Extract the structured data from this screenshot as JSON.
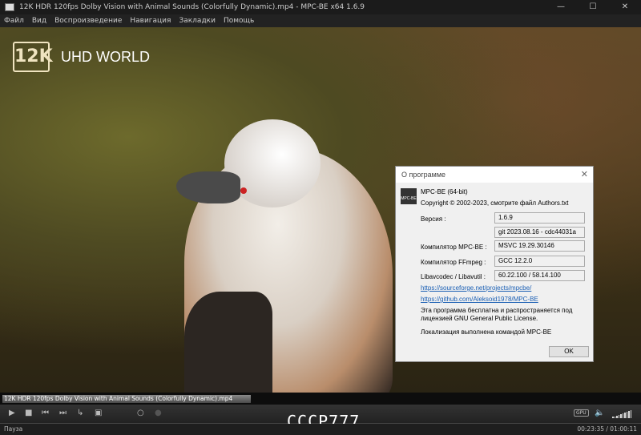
{
  "window": {
    "title": "12K HDR 120fps Dolby Vision with Animal Sounds (Colorfully Dynamic).mp4 - MPC-BE x64 1.6.9",
    "minimize": "—",
    "maximize": "☐",
    "close": "✕"
  },
  "menu": [
    "Файл",
    "Вид",
    "Воспроизведение",
    "Навигация",
    "Закладки",
    "Помощь"
  ],
  "video": {
    "logo_badge": "12K",
    "logo_text": "UHD WORLD",
    "watermark": "CCCP777"
  },
  "about": {
    "title": "О программе",
    "close": "✕",
    "icon_text": "MPC-BE",
    "product": "MPC-BE (64-bit)",
    "copyright": "Copyright © 2002-2023, смотрите файл Authors.txt",
    "rows": [
      {
        "label": "Версия :",
        "value": "1.6.9"
      },
      {
        "label": "",
        "value": "git 2023.08.16 - cdc44031a"
      },
      {
        "label": "Компилятор MPC-BE :",
        "value": "MSVC 19.29.30146"
      },
      {
        "label": "Компилятор FFmpeg :",
        "value": "GCC 12.2.0"
      },
      {
        "label": "Libavcodec / Libavutil :",
        "value": "60.22.100 / 58.14.100"
      }
    ],
    "link1": "https://sourceforge.net/projects/mpcbe/",
    "link2": "https://github.com/Aleksoid1978/MPC-BE",
    "license1": "Эта программа бесплатна и распространяется под",
    "license2": "лицензией GNU General Public License.",
    "localization": "Локализация выполнена командой MPC-BE",
    "ok": "OK"
  },
  "seek": {
    "filename": "12K HDR 120fps Dolby Vision with Animal Sounds (Colorfully Dynamic).mp4",
    "progress": 0.39
  },
  "controls": {
    "play": "▶",
    "stop": "■",
    "prev": "⏮",
    "next": "⏭",
    "gpu": "GPU",
    "volume_icon": "🔈"
  },
  "status": {
    "state": "Пауза",
    "time": "00:23:35 / 01:00:11"
  }
}
